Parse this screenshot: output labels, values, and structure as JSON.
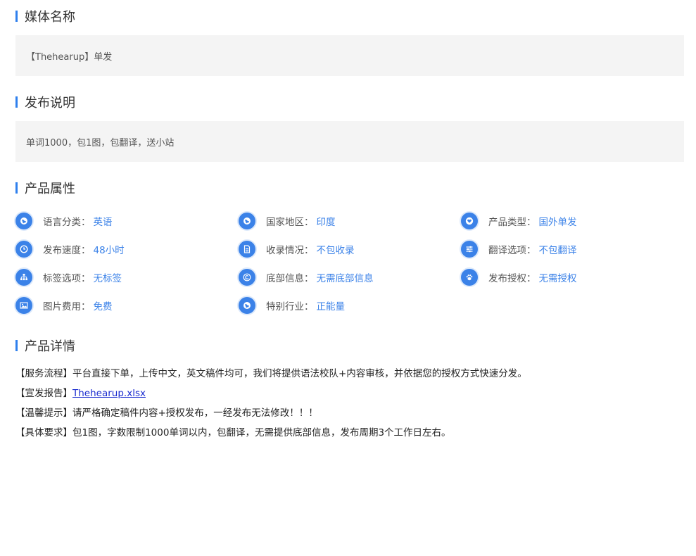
{
  "sections": {
    "media": {
      "title": "媒体名称",
      "value": "【Thehearup】单发"
    },
    "publish": {
      "title": "发布说明",
      "value": "单词1000，包1图，包翻译，送小站"
    },
    "attributes": {
      "title": "产品属性",
      "items": [
        {
          "label": "语言分类：",
          "value": "英语",
          "icon": "globe-icon"
        },
        {
          "label": "国家地区：",
          "value": "印度",
          "icon": "globe-icon"
        },
        {
          "label": "产品类型：",
          "value": "国外单发",
          "icon": "heart-icon"
        },
        {
          "label": "发布速度：",
          "value": "48小时",
          "icon": "clock-icon"
        },
        {
          "label": "收录情况：",
          "value": "不包收录",
          "icon": "document-icon"
        },
        {
          "label": "翻译选项：",
          "value": "不包翻译",
          "icon": "sliders-icon"
        },
        {
          "label": "标签选项：",
          "value": "无标签",
          "icon": "sitemap-icon"
        },
        {
          "label": "底部信息：",
          "value": "无需底部信息",
          "icon": "copyright-icon"
        },
        {
          "label": "发布授权：",
          "value": "无需授权",
          "icon": "paw-icon"
        },
        {
          "label": "图片费用：",
          "value": "免费",
          "icon": "image-icon"
        },
        {
          "label": "特别行业：",
          "value": "正能量",
          "icon": "globe-icon"
        }
      ]
    },
    "details": {
      "title": "产品详情",
      "process_label": "【服务流程】",
      "process_text": "平台直接下单，上传中文，英文稿件均可，我们将提供语法校队+内容审核，并依据您的授权方式快速分发。",
      "report_label": "【宣发报告】",
      "report_link": "Thehearup.xlsx",
      "tip_label": "【温馨提示】",
      "tip_text": "请严格确定稿件内容+授权发布，一经发布无法修改！！！",
      "requirement_label": "【具体要求】",
      "requirement_text": "包1图，字数限制1000单词以内，包翻译，无需提供底部信息，发布周期3个工作日左右。"
    }
  },
  "colors": {
    "accent": "#3b82e8",
    "bar": "#2f80ed",
    "box_bg": "#f4f4f4",
    "link": "#1a2ccf"
  }
}
